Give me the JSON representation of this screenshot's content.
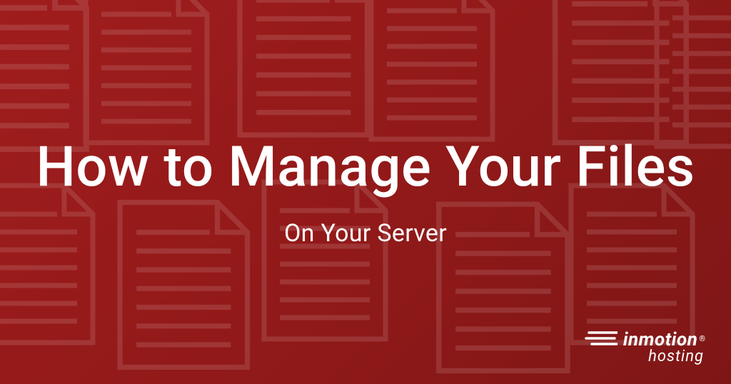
{
  "hero": {
    "title": "How to Manage Your Files",
    "subtitle": "On Your Server"
  },
  "logo": {
    "brand": "inmotion",
    "trademark": "®",
    "sub": "hosting"
  },
  "colors": {
    "background": "#a01e1e",
    "text": "#ffffff"
  }
}
